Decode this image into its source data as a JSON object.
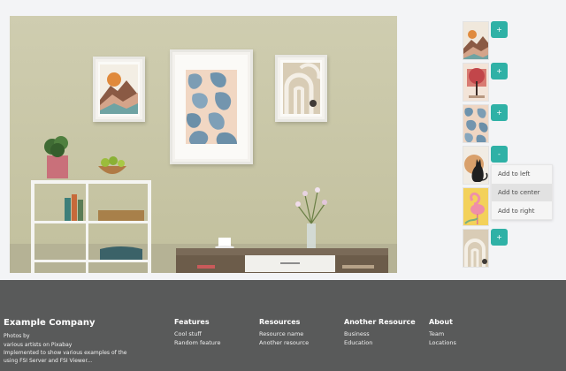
{
  "thumbnails": [
    {
      "icon": "mountain-art-thumbnail",
      "button": "+"
    },
    {
      "icon": "tree-art-thumbnail",
      "button": "+"
    },
    {
      "icon": "leaf-pattern-thumbnail",
      "button": "+"
    },
    {
      "icon": "cat-art-thumbnail",
      "button": "-"
    },
    {
      "icon": "flamingo-art-thumbnail",
      "button": ""
    },
    {
      "icon": "arches-art-thumbnail",
      "button": "+"
    }
  ],
  "context_menu": {
    "items": [
      "Add to left",
      "Add to center",
      "Add to right"
    ]
  },
  "footer": {
    "company_name": "Example Company",
    "description": [
      "Photos by",
      "various artists on Pixabay",
      "Implemented to show various examples of the",
      "using FSI Server and FSI Viewer..."
    ],
    "columns": [
      {
        "title": "Features",
        "links": [
          "Cool stuff",
          "Random feature"
        ]
      },
      {
        "title": "Resources",
        "links": [
          "Resource name",
          "Another resource"
        ]
      },
      {
        "title": "Another Resource",
        "links": [
          "Business",
          "Education"
        ]
      },
      {
        "title": "About",
        "links": [
          "Team",
          "Locations"
        ]
      }
    ]
  },
  "colors": {
    "accent": "#2fb1a6",
    "footer_bg": "#595a5a"
  }
}
